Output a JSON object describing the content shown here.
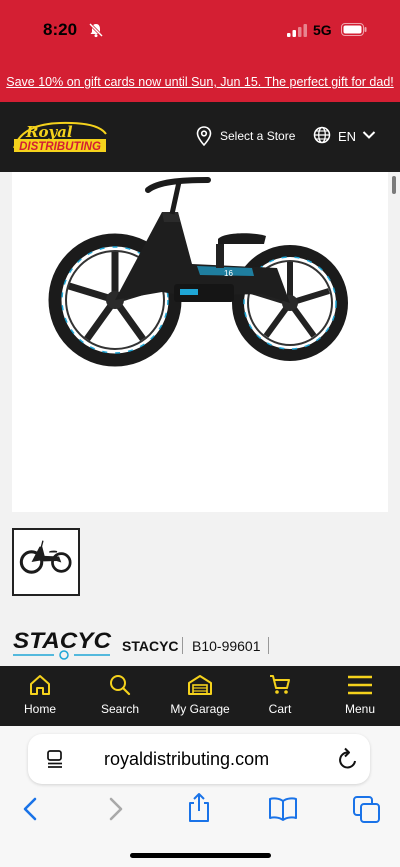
{
  "status_bar": {
    "time": "8:20",
    "network": "5G"
  },
  "promo_banner": {
    "text": "Save 10% on gift cards now until Sun, Jun 15. The perfect gift for dad!"
  },
  "header": {
    "logo_text_top": "Royal",
    "logo_text_bottom": "DISTRIBUTING",
    "store_label": "Select a Store",
    "language": "EN"
  },
  "product": {
    "brand_logo_text": "STACYC",
    "brand": "STACYC",
    "sku": "B10-99601",
    "bike_label": "16"
  },
  "bottom_nav": {
    "items": [
      {
        "label": "Home",
        "icon": "home-icon"
      },
      {
        "label": "Search",
        "icon": "search-icon"
      },
      {
        "label": "My Garage",
        "icon": "garage-icon"
      },
      {
        "label": "Cart",
        "icon": "cart-icon"
      },
      {
        "label": "Menu",
        "icon": "menu-icon"
      }
    ]
  },
  "browser": {
    "url": "royaldistributing.com"
  },
  "colors": {
    "brand_red": "#d41f33",
    "accent_yellow": "#f5d21c",
    "dark": "#1c1c1c",
    "bike_blue": "#1fa6d6",
    "safari_blue": "#1a73e8"
  }
}
